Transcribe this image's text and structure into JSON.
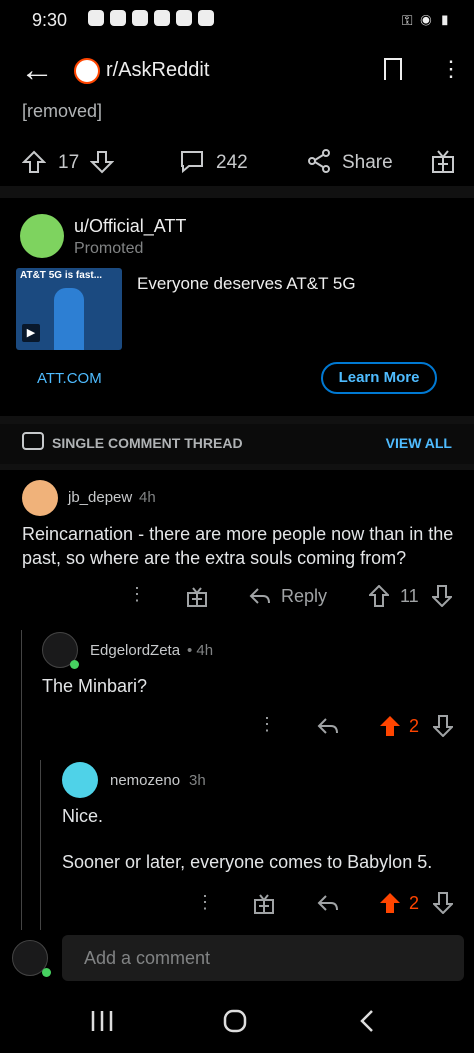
{
  "status_bar": {
    "time": "9:30"
  },
  "header": {
    "subreddit": "r/AskReddit"
  },
  "post": {
    "body": "[removed]",
    "votes": "17",
    "comments": "242",
    "share_label": "Share"
  },
  "ad": {
    "username": "u/Official_ATT",
    "promoted_label": "Promoted",
    "thumb_caption": "AT&T 5G is fast...",
    "title": "Everyone deserves AT&T 5G",
    "link": "ATT.COM",
    "cta": "Learn More"
  },
  "thread": {
    "label": "SINGLE COMMENT THREAD",
    "view_all": "VIEW ALL"
  },
  "comments": [
    {
      "user": "jb_depew",
      "time": "4h",
      "text": "Reincarnation - there are more people now than in the past, so where are the extra souls coming from?",
      "reply_label": "Reply",
      "votes": "11"
    },
    {
      "user": "EdgelordZeta",
      "time": "• 4h",
      "text": "The Minbari?",
      "votes": "2"
    },
    {
      "user": "nemozeno",
      "time": "3h",
      "text_line1": "Nice.",
      "text_line2": "Sooner or later, everyone comes to Babylon 5.",
      "votes": "2"
    }
  ],
  "composer": {
    "placeholder": "Add a comment"
  },
  "colors": {
    "upvote": "#ff4500",
    "link": "#4fbcff",
    "background": "#000000"
  }
}
